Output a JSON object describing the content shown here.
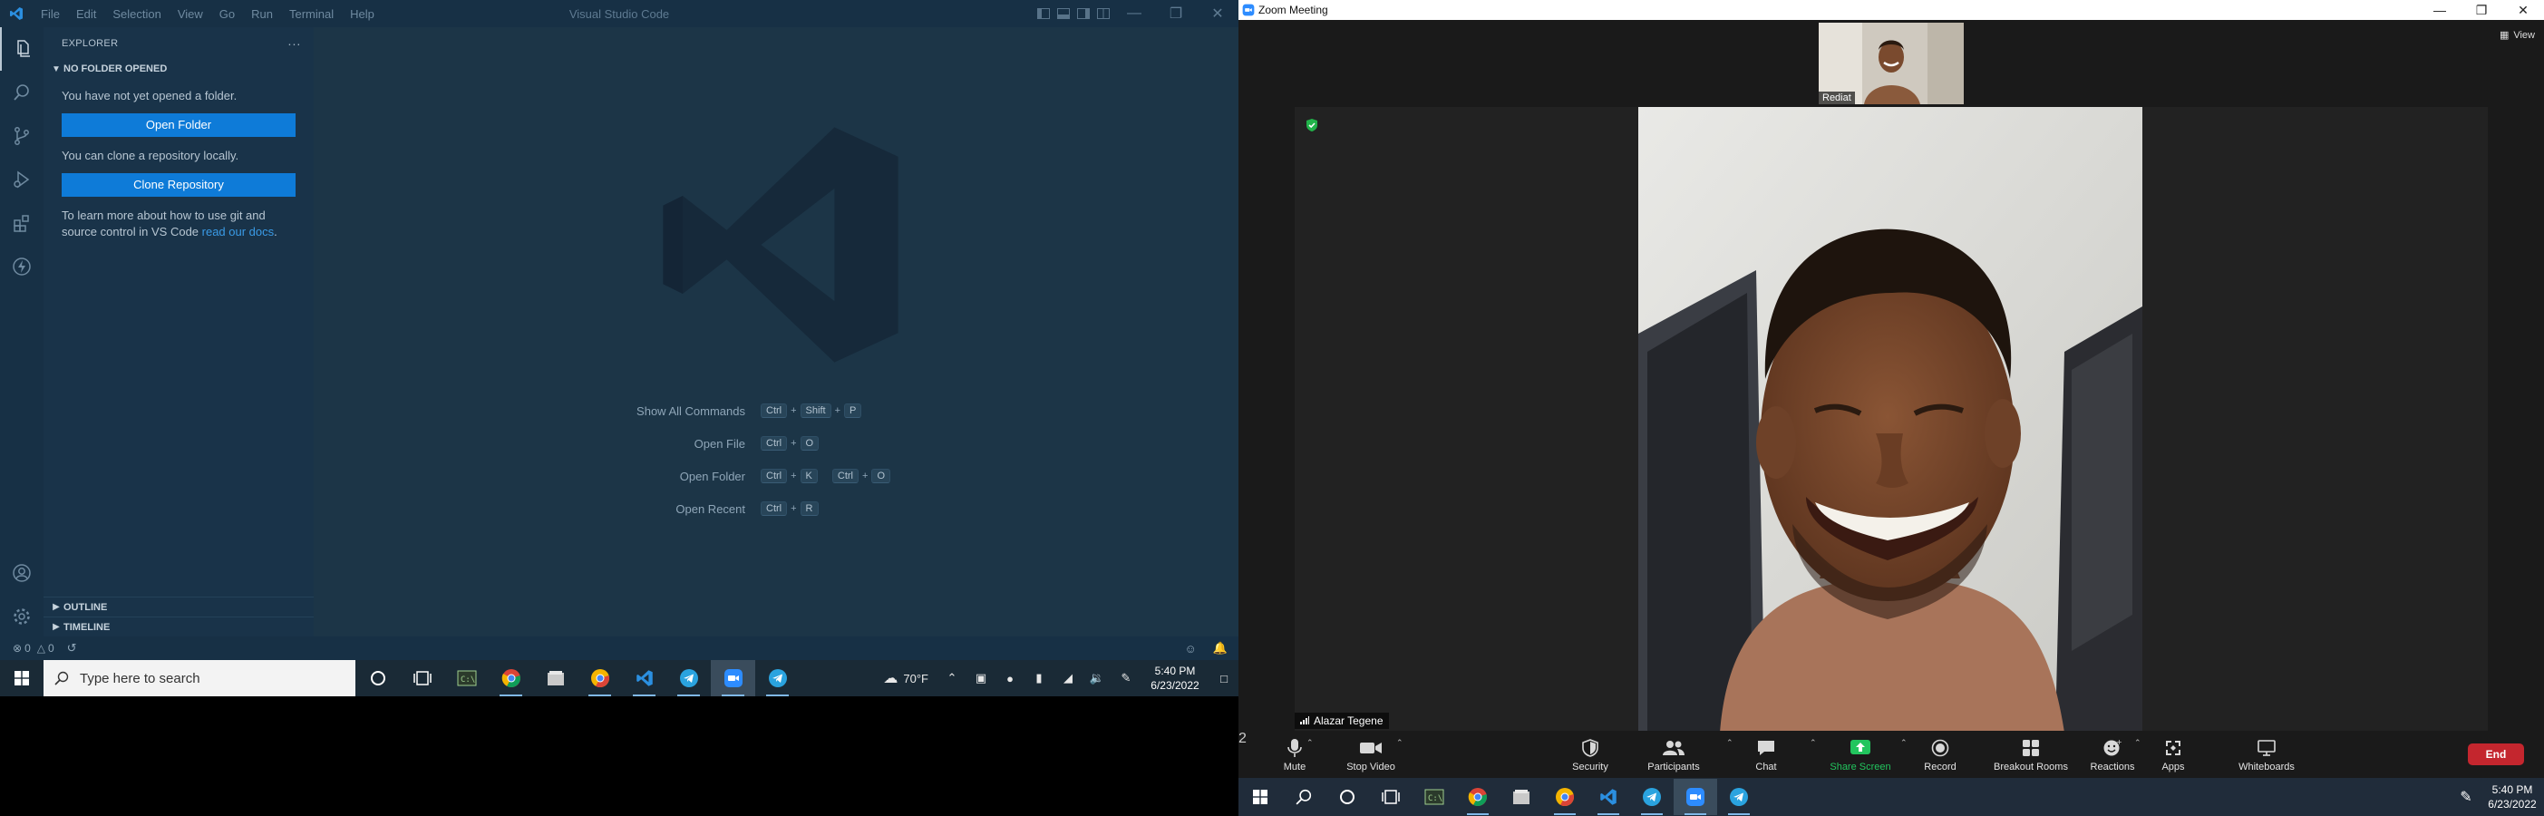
{
  "vscode": {
    "title": "Visual Studio Code",
    "menu": [
      "File",
      "Edit",
      "Selection",
      "View",
      "Go",
      "Run",
      "Terminal",
      "Help"
    ],
    "sidebar": {
      "header": "EXPLORER",
      "more_actions": "···",
      "section": "NO FOLDER OPENED",
      "no_folder_text": "You have not yet opened a folder.",
      "open_folder_button": "Open Folder",
      "clone_text": "You can clone a repository locally.",
      "clone_button": "Clone Repository",
      "learn_text": "To learn more about how to use git and source control in VS Code ",
      "learn_link": "read our docs",
      "learn_end": ".",
      "outline": "OUTLINE",
      "timeline": "TIMELINE"
    },
    "shortcuts": [
      {
        "label": "Show All Commands",
        "keys": [
          [
            "Ctrl",
            "Shift",
            "P"
          ]
        ]
      },
      {
        "label": "Open File",
        "keys": [
          [
            "Ctrl",
            "O"
          ]
        ]
      },
      {
        "label": "Open Folder",
        "keys": [
          [
            "Ctrl",
            "K"
          ],
          [
            "Ctrl",
            "O"
          ]
        ]
      },
      {
        "label": "Open Recent",
        "keys": [
          [
            "Ctrl",
            "R"
          ]
        ]
      }
    ],
    "statusbar": {
      "errors": "0",
      "warnings": "0"
    },
    "colors": {
      "accent": "#0e7bd8",
      "background": "#1c3547",
      "link": "#3a9be6"
    }
  },
  "left_taskbar": {
    "search_placeholder": "Type here to search",
    "weather": "70°F",
    "time": "5:40 PM",
    "date": "6/23/2022",
    "apps": [
      "cortana-icon",
      "task-view-icon",
      "terminal-icon",
      "chrome-icon",
      "files-icon",
      "chrome-icon",
      "vscode-icon",
      "telegram-icon",
      "zoom-icon",
      "telegram-icon"
    ]
  },
  "zoom": {
    "window_title": "Zoom Meeting",
    "view_label": "View",
    "thumbnail_name": "Rediat",
    "speaker_name": "Alazar Tegene",
    "participants_count": "2",
    "toolbar": {
      "mute": "Mute",
      "stop_video": "Stop Video",
      "security": "Security",
      "participants": "Participants",
      "chat": "Chat",
      "share_screen": "Share Screen",
      "record": "Record",
      "breakout_rooms": "Breakout Rooms",
      "reactions": "Reactions",
      "apps": "Apps",
      "whiteboards": "Whiteboards",
      "end": "End"
    },
    "colors": {
      "share": "#22c55e",
      "end": "#c4262e"
    }
  },
  "right_taskbar": {
    "time": "5:40 PM",
    "date": "6/23/2022"
  }
}
